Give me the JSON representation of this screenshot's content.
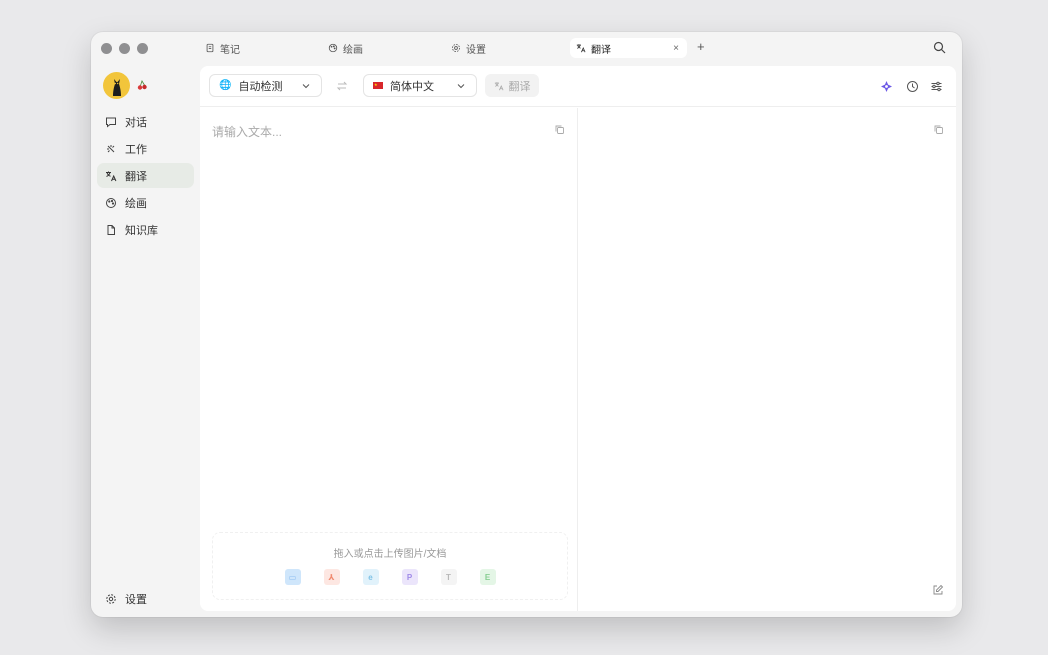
{
  "tabs": [
    {
      "label": "笔记",
      "icon": "note-icon"
    },
    {
      "label": "绘画",
      "icon": "palette-icon"
    },
    {
      "label": "设置",
      "icon": "gear-icon"
    },
    {
      "label": "翻译",
      "icon": "translate-icon",
      "active": true
    }
  ],
  "tab_close": "×",
  "tab_add": "+",
  "sidebar": {
    "items": [
      {
        "label": "对话",
        "icon": "chat-icon"
      },
      {
        "label": "工作",
        "icon": "sparkle-icon"
      },
      {
        "label": "翻译",
        "icon": "translate-icon",
        "active": true
      },
      {
        "label": "绘画",
        "icon": "palette-icon"
      },
      {
        "label": "知识库",
        "icon": "file-icon"
      }
    ],
    "settings_label": "设置"
  },
  "toolbar": {
    "source_lang": "自动检测",
    "target_lang": "简体中文",
    "translate_label": "翻译"
  },
  "input": {
    "placeholder": "请输入文本..."
  },
  "upload": {
    "hint": "拖入或点击上传图片/文档",
    "file_types": [
      {
        "label": "▭",
        "color": "#cfe6fb",
        "text_color": "#8cbdf0"
      },
      {
        "label": "⅄",
        "color": "#fde7e2",
        "text_color": "#f08a6f"
      },
      {
        "label": "e",
        "color": "#e1f2fb",
        "text_color": "#7fc2e6"
      },
      {
        "label": "P",
        "color": "#ebe5fb",
        "text_color": "#a08be8"
      },
      {
        "label": "T",
        "color": "#f4f4f4",
        "text_color": "#b8b8b8"
      },
      {
        "label": "E",
        "color": "#e4f6e6",
        "text_color": "#88cf92"
      }
    ]
  },
  "colors": {
    "accent": "#6d5ae6",
    "active_nav": "#e7ebe6"
  }
}
